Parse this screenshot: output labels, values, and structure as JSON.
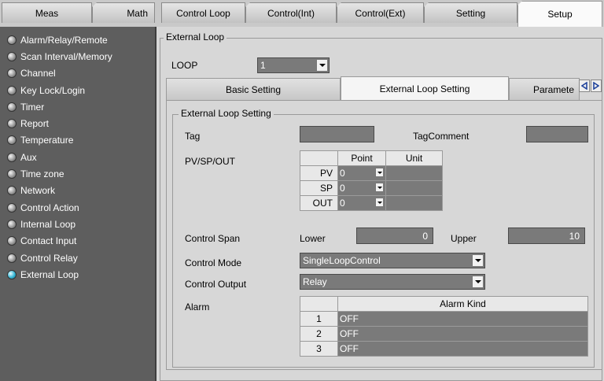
{
  "top_tabs": [
    "Meas",
    "Math",
    "Control Loop",
    "Control(Int)",
    "Control(Ext)",
    "Setting",
    "Setup"
  ],
  "active_top_tab": "Setup",
  "sidebar": {
    "items": [
      {
        "label": "Alarm/Relay/Remote"
      },
      {
        "label": "Scan Interval/Memory"
      },
      {
        "label": "Channel"
      },
      {
        "label": "Key Lock/Login"
      },
      {
        "label": "Timer"
      },
      {
        "label": "Report"
      },
      {
        "label": "Temperature"
      },
      {
        "label": "Aux"
      },
      {
        "label": "Time zone"
      },
      {
        "label": "Network"
      },
      {
        "label": "Control Action"
      },
      {
        "label": "Internal Loop"
      },
      {
        "label": "Contact Input"
      },
      {
        "label": "Control Relay"
      },
      {
        "label": "External Loop"
      }
    ],
    "active": "External Loop"
  },
  "external_loop": {
    "group_title": "External Loop",
    "loop_label": "LOOP",
    "loop_value": "1"
  },
  "inner_tabs": [
    "Basic Setting",
    "External Loop Setting",
    "Paramete"
  ],
  "active_inner_tab": "External Loop Setting",
  "settings": {
    "group_title": "External Loop Setting",
    "tag_label": "Tag",
    "tag_value": "",
    "tag_comment_label": "TagComment",
    "tag_comment_value": "",
    "pvspout_label": "PV/SP/OUT",
    "pv_table": {
      "headers": [
        "Point",
        "Unit"
      ],
      "rows": [
        {
          "label": "PV",
          "point": "0",
          "unit": ""
        },
        {
          "label": "SP",
          "point": "0",
          "unit": ""
        },
        {
          "label": "OUT",
          "point": "0",
          "unit": ""
        }
      ]
    },
    "control_span_label": "Control Span",
    "lower_label": "Lower",
    "lower_value": "0",
    "upper_label": "Upper",
    "upper_value": "10",
    "control_mode_label": "Control Mode",
    "control_mode_value": "SingleLoopControl",
    "control_output_label": "Control Output",
    "control_output_value": "Relay",
    "alarm_label": "Alarm",
    "alarm_table": {
      "header": "Alarm Kind",
      "rows": [
        {
          "num": "1",
          "kind": "OFF"
        },
        {
          "num": "2",
          "kind": "OFF"
        },
        {
          "num": "3",
          "kind": "OFF"
        }
      ]
    }
  },
  "colors": {
    "sidebar_bg": "#5e5e5e",
    "field_bg": "#7a7a7a",
    "active_bullet": "#35b7d6",
    "panel_bg": "#d7d7d7"
  }
}
